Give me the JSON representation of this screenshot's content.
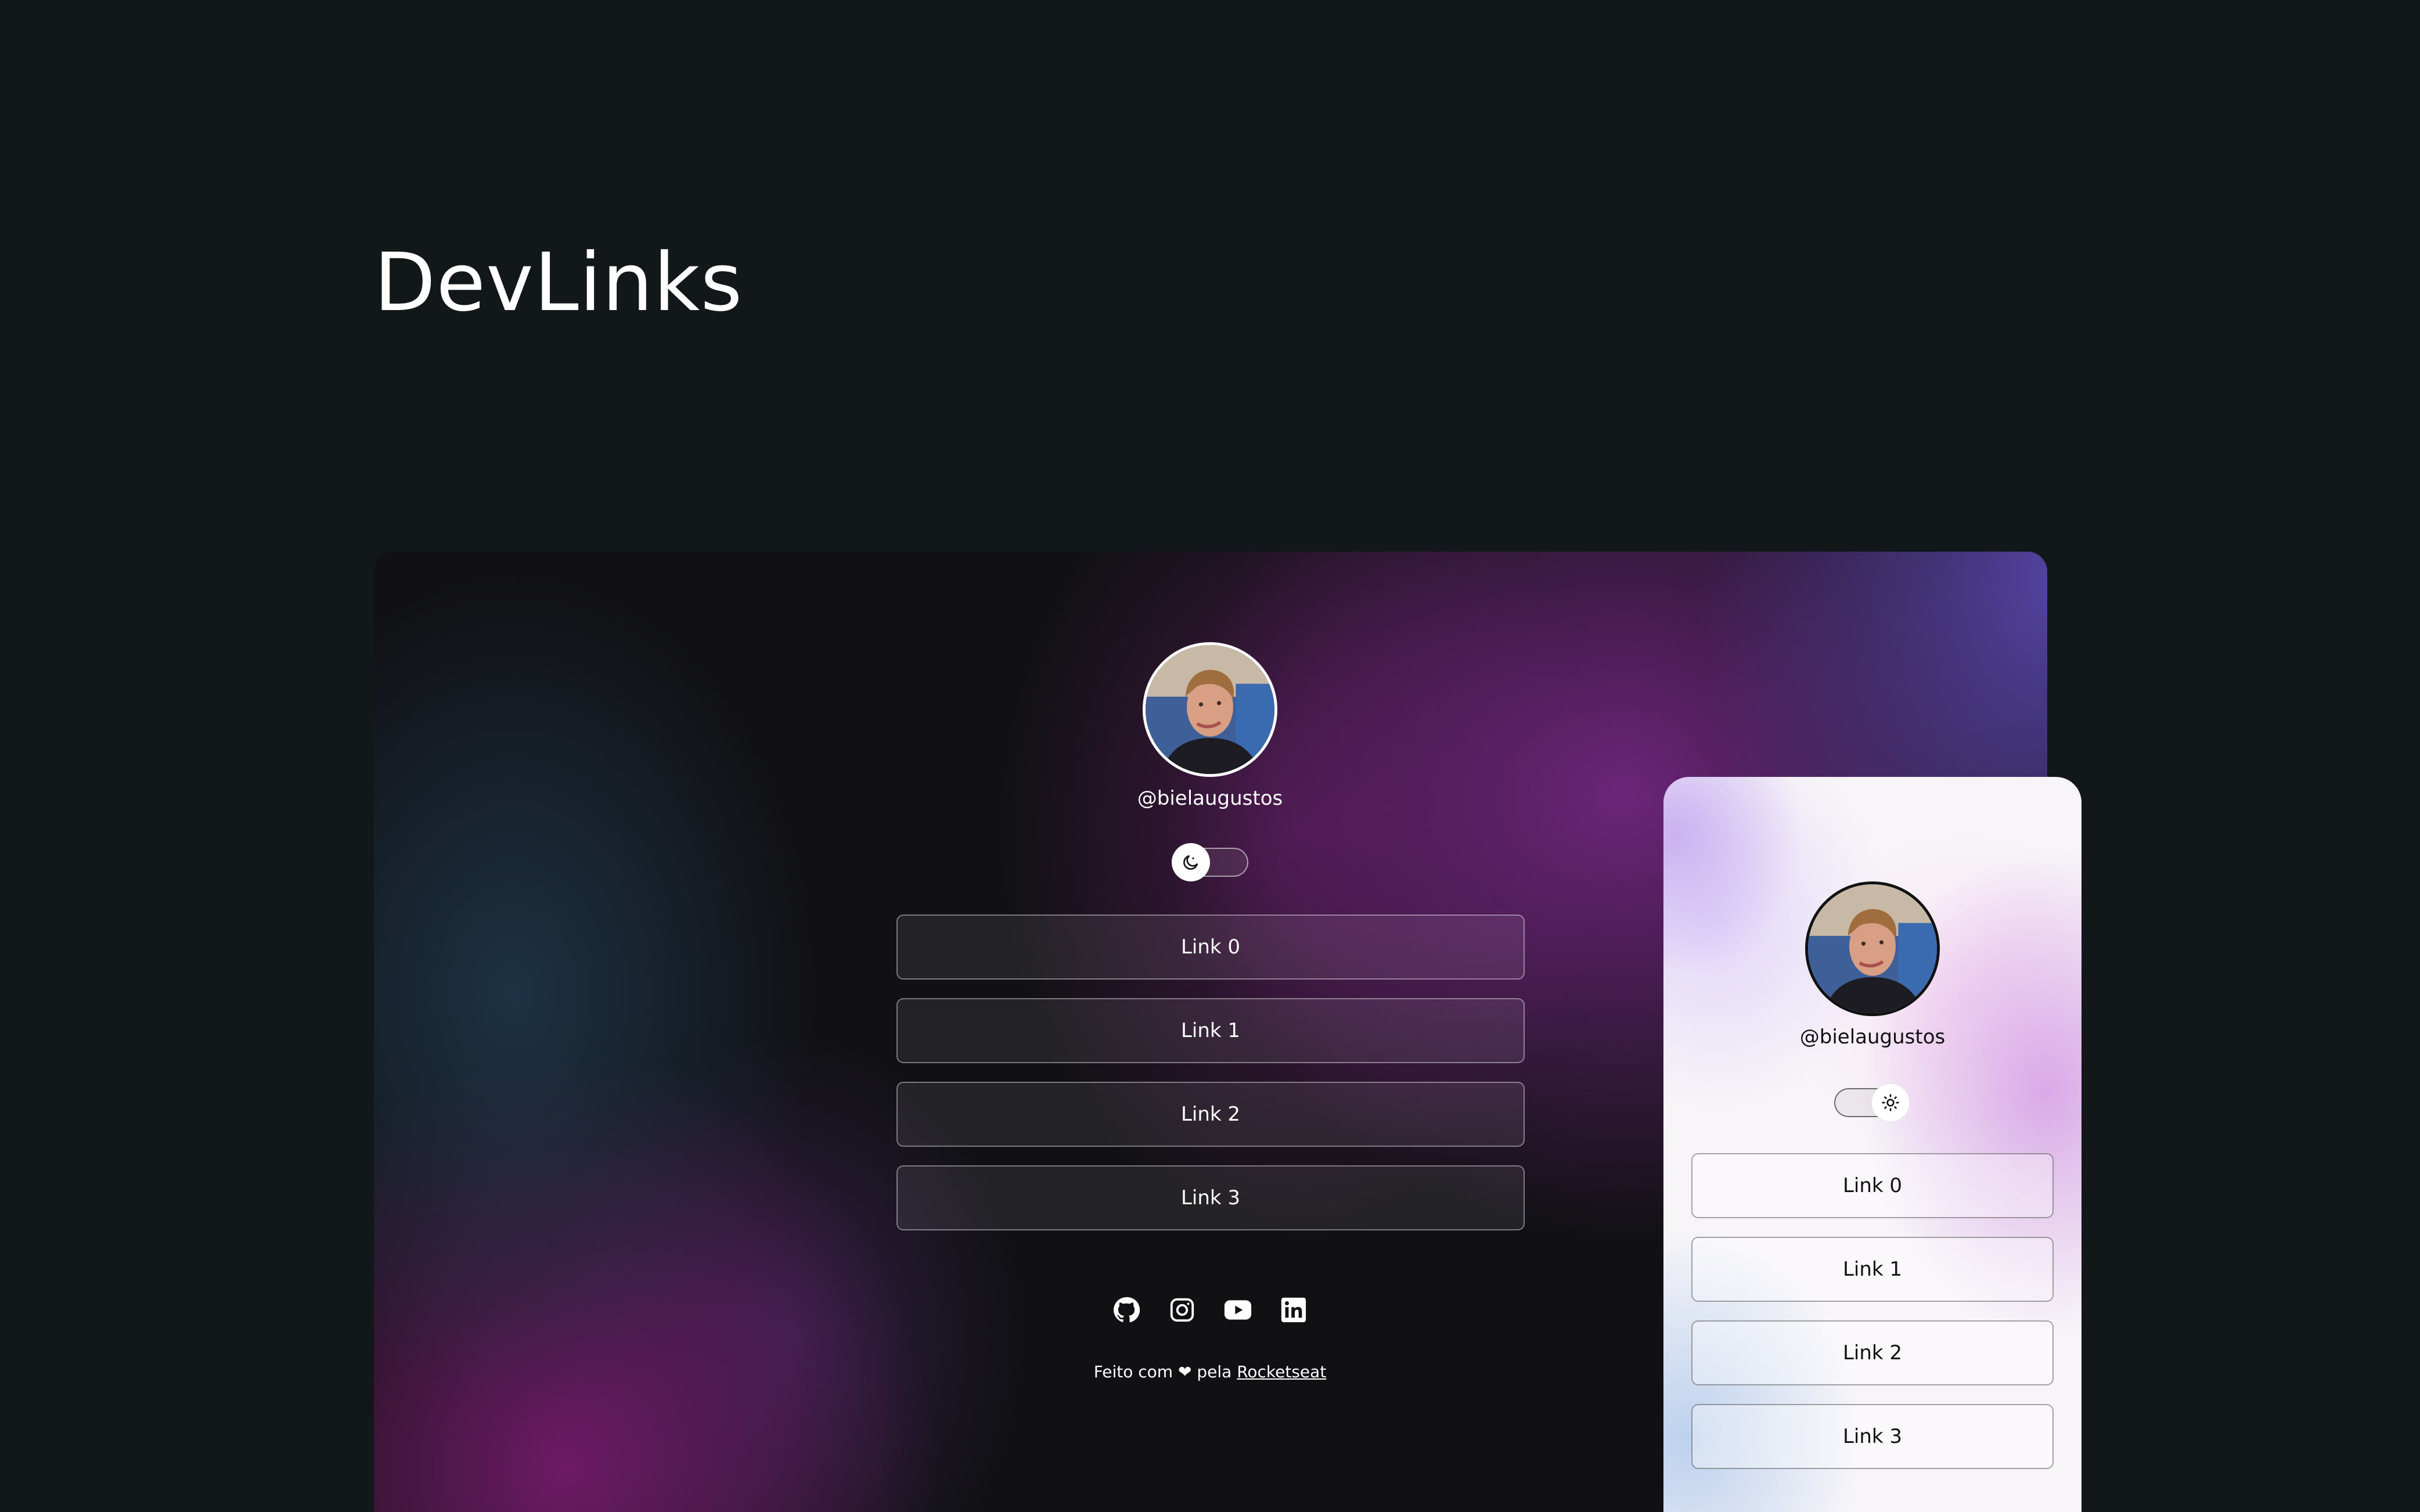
{
  "page": {
    "title": "DevLinks"
  },
  "dark_preview": {
    "username": "@bielaugustos",
    "theme_toggle_icon": "moon-icon",
    "links": [
      {
        "label": "Link 0"
      },
      {
        "label": "Link 1"
      },
      {
        "label": "Link 2"
      },
      {
        "label": "Link 3"
      }
    ],
    "social_icons": [
      "github-icon",
      "instagram-icon",
      "youtube-icon",
      "linkedin-icon"
    ],
    "footer": {
      "prefix": "Feito com",
      "heart": "❤",
      "middle": "pela",
      "link_text": "Rocketseat"
    }
  },
  "light_preview": {
    "username": "@bielaugustos",
    "theme_toggle_icon": "sun-icon",
    "links": [
      {
        "label": "Link 0"
      },
      {
        "label": "Link 1"
      },
      {
        "label": "Link 2"
      },
      {
        "label": "Link 3"
      }
    ]
  },
  "colors": {
    "page_background": "#121719",
    "dark_text": "#ffffff",
    "light_text": "#111111",
    "accent_purple": "#7d288c"
  }
}
